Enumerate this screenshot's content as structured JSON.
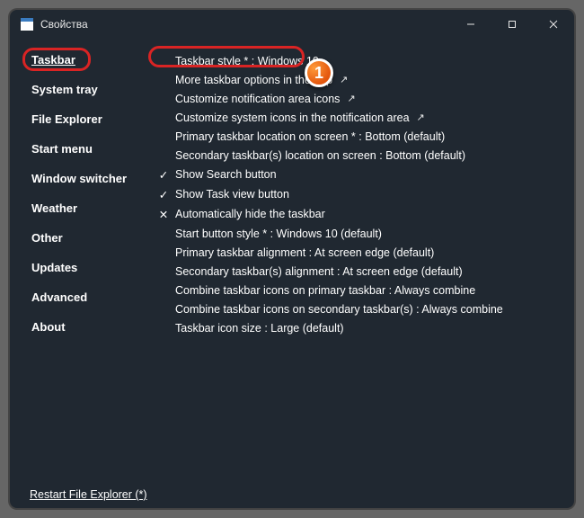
{
  "window": {
    "title": "Свойства"
  },
  "sidebar": {
    "items": [
      {
        "label": "Taskbar",
        "active": true
      },
      {
        "label": "System tray"
      },
      {
        "label": "File Explorer"
      },
      {
        "label": "Start menu"
      },
      {
        "label": "Window switcher"
      },
      {
        "label": "Weather"
      },
      {
        "label": "Other"
      },
      {
        "label": "Updates"
      },
      {
        "label": "Advanced"
      },
      {
        "label": "About"
      }
    ],
    "restart": "Restart File Explorer (*)"
  },
  "content": {
    "rows": [
      {
        "text": "Taskbar style * : Windows 10",
        "indent": 0,
        "icon": ""
      },
      {
        "text": "More taskbar options in the             app",
        "indent": 0,
        "icon": "link"
      },
      {
        "text": "Customize notification area icons",
        "indent": 0,
        "icon": "link"
      },
      {
        "text": "Customize system icons in the notification area",
        "indent": 0,
        "icon": "link"
      },
      {
        "text": "Primary taskbar location on screen * : Bottom (default)",
        "indent": 1,
        "icon": ""
      },
      {
        "text": "Secondary taskbar(s) location on screen : Bottom (default)",
        "indent": 1,
        "icon": ""
      },
      {
        "text": "Show Search button",
        "indent": 0,
        "icon": "check"
      },
      {
        "text": "Show Task view button",
        "indent": 0,
        "icon": "check"
      },
      {
        "text": "Automatically hide the taskbar",
        "indent": 0,
        "icon": "cross"
      },
      {
        "text": "Start button style * : Windows 10 (default)",
        "indent": 1,
        "icon": ""
      },
      {
        "text": "Primary taskbar alignment : At screen edge (default)",
        "indent": 1,
        "icon": ""
      },
      {
        "text": "Secondary taskbar(s) alignment : At screen edge (default)",
        "indent": 1,
        "icon": ""
      },
      {
        "text": "Combine taskbar icons on primary taskbar : Always combine",
        "indent": 1,
        "icon": ""
      },
      {
        "text": "Combine taskbar icons on secondary taskbar(s) : Always combine",
        "indent": 1,
        "icon": ""
      },
      {
        "text": "Taskbar icon size : Large (default)",
        "indent": 1,
        "icon": ""
      }
    ]
  },
  "marker": {
    "label": "1"
  }
}
